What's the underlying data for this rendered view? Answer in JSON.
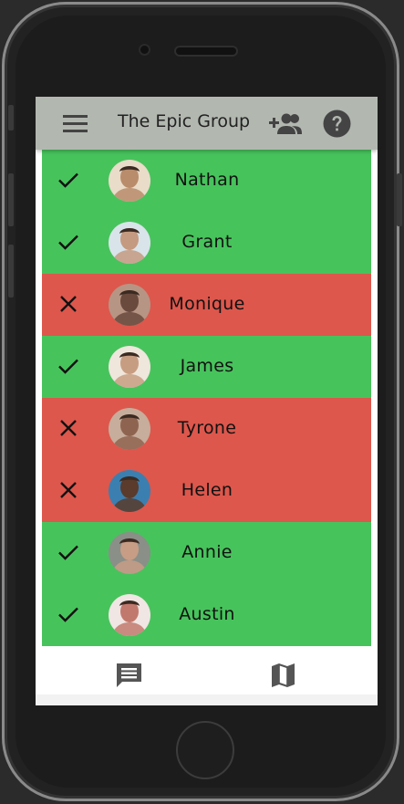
{
  "app": {
    "title": "The Epic Group",
    "appbar_color": "#b2b8b0",
    "icon_color": "#444444"
  },
  "header": {
    "menu_icon": "menu-icon",
    "add_member_icon": "group-add-icon",
    "help_icon": "help-icon"
  },
  "status_colors": {
    "yes": "#47c35c",
    "no": "#dd574c"
  },
  "members": [
    {
      "name": "Nathan",
      "status": "yes",
      "avatar_bg": "#e9dcc9",
      "avatar_fg": "#b98c6b"
    },
    {
      "name": "Grant",
      "status": "yes",
      "avatar_bg": "#d9e4ea",
      "avatar_fg": "#c49a80"
    },
    {
      "name": "Monique",
      "status": "no",
      "avatar_bg": "#b79584",
      "avatar_fg": "#6a4a3d"
    },
    {
      "name": "James",
      "status": "yes",
      "avatar_bg": "#efe6dc",
      "avatar_fg": "#c79d82"
    },
    {
      "name": "Tyrone",
      "status": "no",
      "avatar_bg": "#c7ad9b",
      "avatar_fg": "#8e6450"
    },
    {
      "name": "Helen",
      "status": "no",
      "avatar_bg": "#3b7fb0",
      "avatar_fg": "#5a3b2c"
    },
    {
      "name": "Annie",
      "status": "yes",
      "avatar_bg": "#8a8f88",
      "avatar_fg": "#c79d86"
    },
    {
      "name": "Austin",
      "status": "yes",
      "avatar_bg": "#f0e6e3",
      "avatar_fg": "#c2796d"
    }
  ],
  "bottom_nav": {
    "items": [
      {
        "icon": "chat-icon"
      },
      {
        "icon": "map-icon"
      }
    ]
  }
}
